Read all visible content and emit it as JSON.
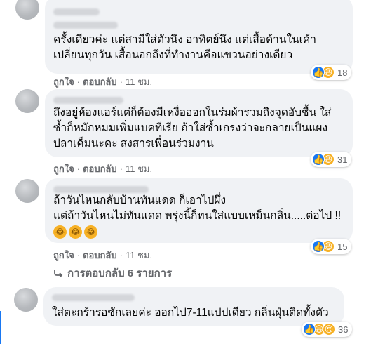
{
  "comments": [
    {
      "text": "ครั้งเดียวค่ะ แต่สามีใส่ตัวนึง อาทิตย์นึง แต่เสื้อด้านในเค้า\nเปลี่ยนทุกวัน เสื้อนอกถึงที่ทำงานคือแขวนอย่างเดียว",
      "like_label": "ถูกใจ",
      "reply_label": "ตอบกลับ",
      "time": "11 ชม.",
      "reaction_count": "18"
    },
    {
      "text": "ถึงอยู่ห้องแอร์แต่ก็ต้องมีเหงื่อออกในร่มผ้ารวมถึงจุดอับชื้น ใส่\nซ้ำก็หมักหมมเพิ่มแบคทีเรีย ถ้าใส่ซ้ำเกรงว่าจะกลายเป็นแผง\nปลาเค็มนะคะ สงสารเพื่อนร่วมงาน",
      "like_label": "ถูกใจ",
      "reply_label": "ตอบกลับ",
      "time": "11 ชม.",
      "reaction_count": "31"
    },
    {
      "text": "ถ้าวันไหนกลับบ้านทันแดด ก็เอาไปผึ่ง\nแต่ถ้าวันไหนไม่ทันแดด พรุ่งนี้ก็ทนใส่แบบเหม็นกลิ่น.....ต่อไป !!",
      "like_label": "ถูกใจ",
      "reply_label": "ตอบกลับ",
      "time": "11 ชม.",
      "reaction_count": "15"
    },
    {
      "text": "ใส่ตะกร้ารอซักเลยค่ะ ออกไป7-11แปปเดียว กลิ่นฝุ่นติดทั้งตัว",
      "reaction_count": "36"
    }
  ],
  "replies_link": "การตอบกลับ 6 รายการ",
  "separator": "·",
  "colors": {
    "bubble": "#f0f2f5",
    "meta": "#65676b",
    "like_blue": "#1877f2",
    "haha_yellow": "#f7b125"
  }
}
